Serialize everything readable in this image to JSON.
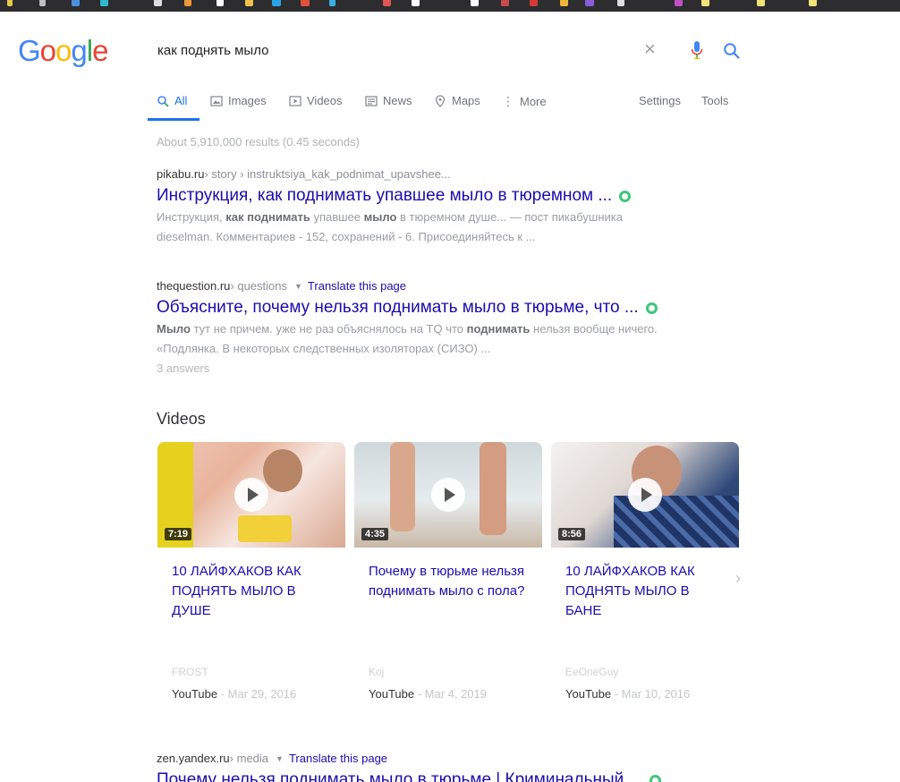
{
  "brand": {
    "logo_text": [
      "G",
      "o",
      "o",
      "g",
      "l",
      "e"
    ],
    "colors": [
      "#4285f4",
      "#ea4335",
      "#fbbc05",
      "#4285f4",
      "#34a853",
      "#ea4335"
    ]
  },
  "search": {
    "query": "как поднять мыло"
  },
  "tabs": {
    "all": "All",
    "images": "Images",
    "videos": "Videos",
    "news": "News",
    "maps": "Maps",
    "more": "More",
    "settings": "Settings",
    "tools": "Tools"
  },
  "stats": "About 5,910,000 results (0.45 seconds)",
  "results": [
    {
      "domain": "pikabu.ru",
      "crumb": " › story › instruktsiya_kak_podnimat_upavshee...",
      "title": "Инструкция, как поднимать упавшее мыло в тюремном ...",
      "snippet_parts": [
        "Инструкция, ",
        "как поднимать",
        " упавшее ",
        "мыло",
        " в тюремном душе... — пост пикабушника dieselman. Комментариев - 152, сохранений - 6. Присоединяйтесь к ..."
      ]
    },
    {
      "domain": "thequestion.ru",
      "crumb": " › questions",
      "translate": "Translate this page",
      "title": "Объясните, почему нельзя поднимать мыло в тюрьме, что ...",
      "snippet_parts": [
        "Мыло",
        " тут не причем. уже не раз объяснялось на TQ что ",
        "поднимать",
        " нельзя вообще ничего. «Подлянка. В некоторых следственных изоляторах (СИЗО) ..."
      ],
      "answers": "3 answers"
    },
    {
      "domain": "zen.yandex.ru",
      "crumb": " › media",
      "translate": "Translate this page",
      "title": "Почему нельзя поднимать мыло в тюрьме | Криминальный ..."
    }
  ],
  "videos": {
    "heading": "Videos",
    "items": [
      {
        "duration": "7:19",
        "title": "10 ЛАЙФХАКОВ КАК ПОДНЯТЬ МЫЛО В ДУШЕ",
        "channel": "FROST",
        "source": "YouTube",
        "date": " - Mar 29, 2016"
      },
      {
        "duration": "4:35",
        "title": "Почему в тюрьме нельзя поднимать мыло с пола?",
        "channel": "Koj",
        "source": "YouTube",
        "date": " - Mar 4, 2019"
      },
      {
        "duration": "8:56",
        "title": "10 ЛАЙФХАКОВ КАК ПОДНЯТЬ МЫЛО В БАНЕ",
        "channel": "EeOneGuy",
        "source": "YouTube",
        "date": " - Mar 10, 2016"
      }
    ],
    "next_icon": "chevron-right-icon"
  }
}
